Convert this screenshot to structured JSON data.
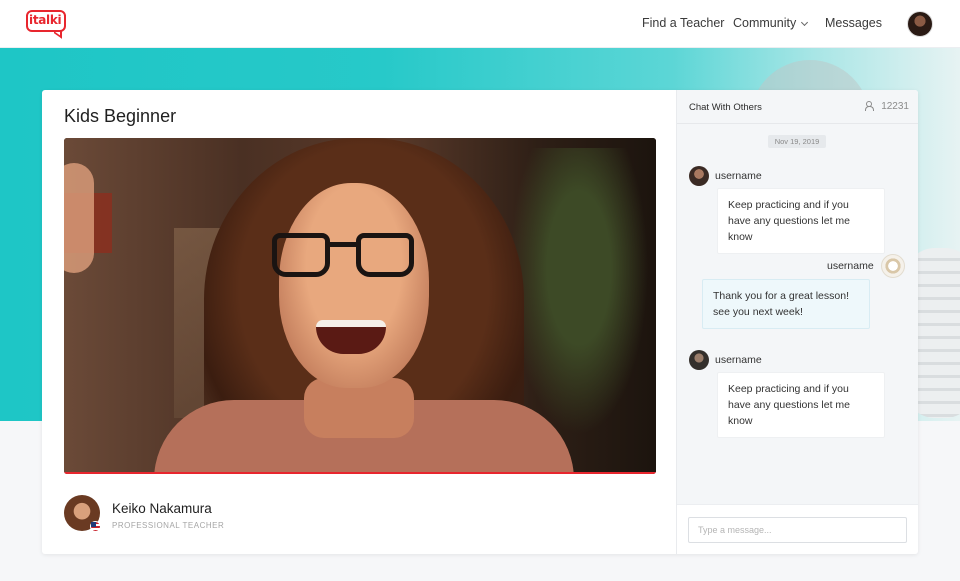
{
  "nav": {
    "logo_text": "italki",
    "links": [
      "Find a Teacher",
      "Community",
      "Messages"
    ]
  },
  "lesson": {
    "title": "Kids Beginner"
  },
  "teacher": {
    "name": "Keiko Nakamura",
    "role": "PROFESSIONAL TEACHER"
  },
  "chat": {
    "title": "Chat With Others",
    "viewer_count": "12231",
    "date": "Nov 19, 2019",
    "messages": [
      {
        "user": "username",
        "text": "Keep practicing and if you have any questions let me know",
        "own": false
      },
      {
        "user": "username",
        "text": "Thank you for a great lesson! see you next week!",
        "own": true
      },
      {
        "user": "username",
        "text": "Keep practicing and if you have any questions let me know",
        "own": false
      }
    ],
    "input_placeholder": "Type a message..."
  },
  "colors": {
    "brand_red": "#e8262e",
    "hero_teal": "#1ec6c6"
  },
  "icons": [
    "users-icon",
    "chevron-down-icon",
    "flag-icon"
  ]
}
